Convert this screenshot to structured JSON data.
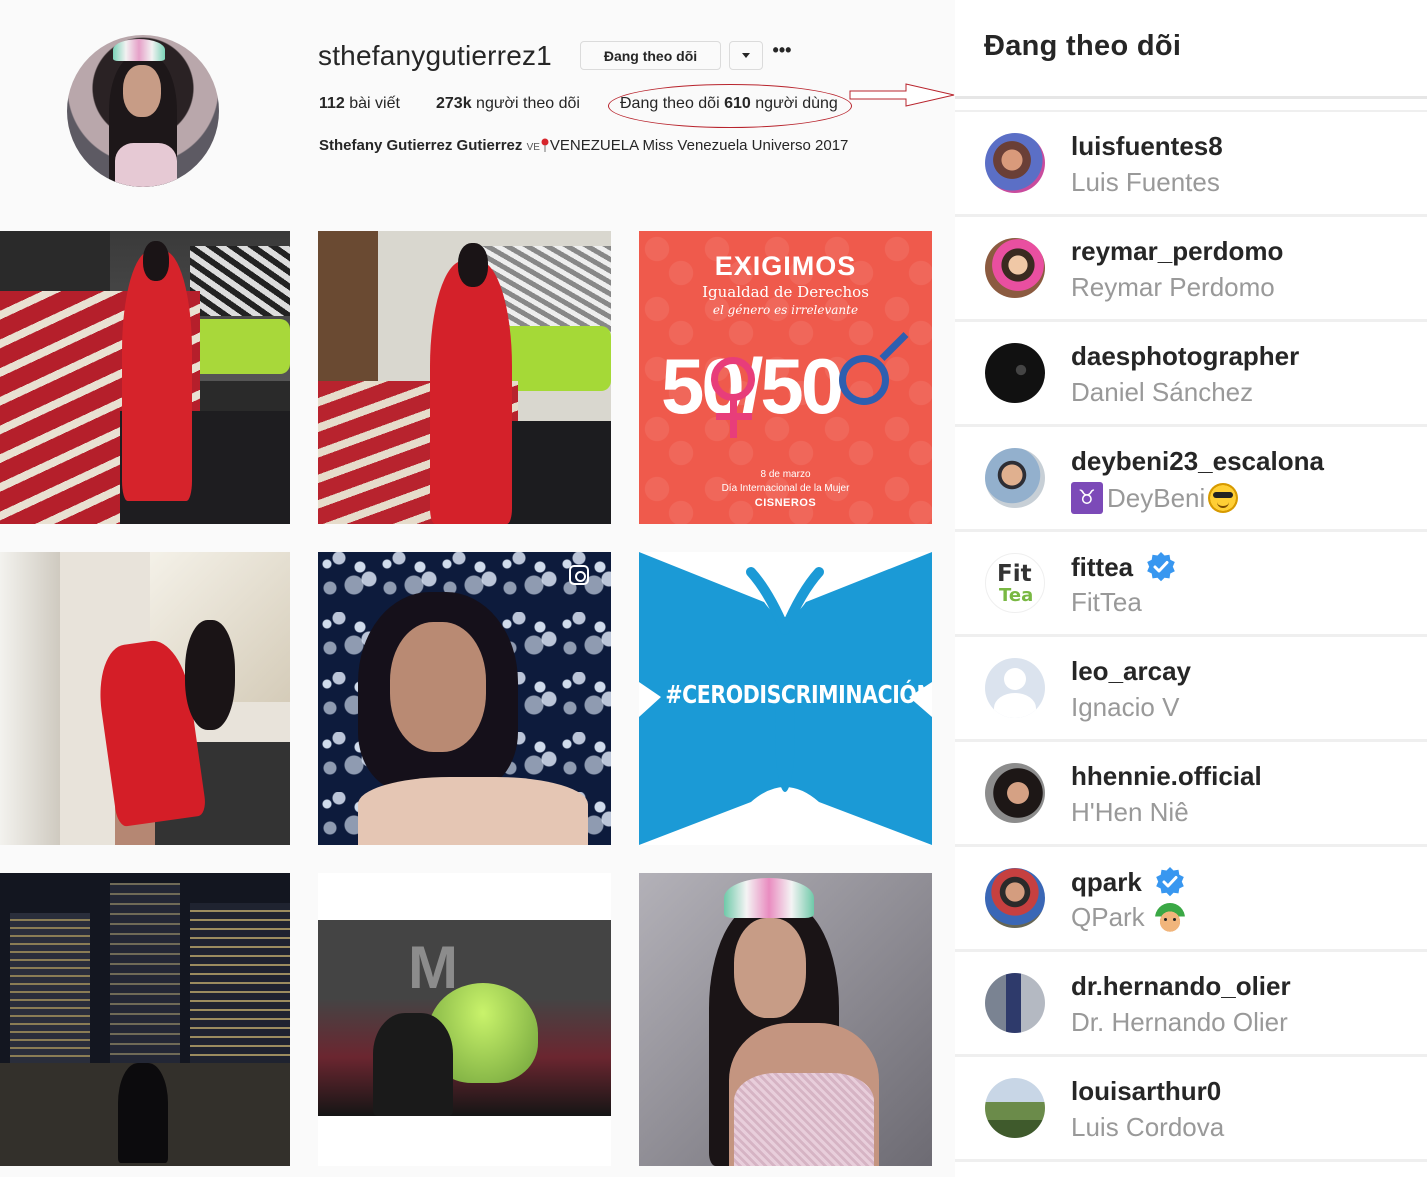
{
  "profile": {
    "username": "sthefanygutierrez1",
    "following_button_label": "Đang theo dõi",
    "more_icon": "•••",
    "stats": {
      "posts_count": "112",
      "posts_label": " bài viết",
      "followers_count": "273k",
      "followers_label": " người theo dõi",
      "following_prefix": "Đang theo dõi ",
      "following_count": "610",
      "following_suffix": " người dùng"
    },
    "bio": {
      "full_name": "Sthefany Gutierrez Gutierrez",
      "flag_code": "VE",
      "text": "VENEZUELA Miss Venezuela Universo 2017"
    },
    "annotation_color": "#b8242d"
  },
  "posts": {
    "tile3": {
      "headline": "EXIGIMOS",
      "subheadline": "Igualdad de Derechos",
      "tagline": "el género es irrelevante",
      "big": "50/50",
      "footer_date": "8 de marzo",
      "footer_event": "Día Internacional de la Mujer",
      "footer_brand": "CISNEROS"
    },
    "tile6": {
      "hashtag": "#CERODISCRIMINACIÓN",
      "color": "#1b9ad6"
    }
  },
  "following_panel": {
    "title": "Đang theo dõi",
    "verified_color": "#3897f0",
    "users": [
      {
        "username": "luisfuentes8",
        "full_name": "Luis Fuentes"
      },
      {
        "username": "reymar_perdomo",
        "full_name": "Reymar Perdomo"
      },
      {
        "username": "daesphotographer",
        "full_name": "Daniel Sánchez"
      },
      {
        "username": "deybeni23_escalona",
        "full_name": "DeyBeni",
        "full_name_prefix_emoji": "taurus",
        "full_name_suffix_emoji": "smiling-face-with-sunglasses"
      },
      {
        "username": "fittea",
        "full_name": "FitTea",
        "verified": true,
        "avatar_text_top": "Fit",
        "avatar_text_bottom": "Tea"
      },
      {
        "username": "leo_arcay",
        "full_name": "Ignacio V"
      },
      {
        "username": "hhennie.official",
        "full_name": "H'Hen Niê"
      },
      {
        "username": "qpark",
        "full_name": "QPark",
        "verified": true,
        "full_name_suffix_emoji": "elf"
      },
      {
        "username": "dr.hernando_olier",
        "full_name": "Dr. Hernando Olier"
      },
      {
        "username": "louisarthur0",
        "full_name": "Luis Cordova"
      }
    ]
  }
}
